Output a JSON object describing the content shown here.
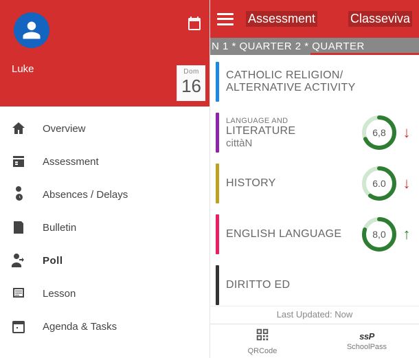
{
  "left": {
    "username": "Luke",
    "day": {
      "dow": "Dom",
      "num": "16"
    },
    "menu": [
      {
        "label": "Overview",
        "icon": "home",
        "bold": false
      },
      {
        "label": "Assessment",
        "icon": "grade",
        "bold": false
      },
      {
        "label": "Absences / Delays",
        "icon": "absence",
        "bold": false
      },
      {
        "label": "Bulletin",
        "icon": "bulletin",
        "bold": false
      },
      {
        "label": "Poll",
        "icon": "poll",
        "bold": true
      },
      {
        "label": "Lesson",
        "icon": "lesson",
        "bold": false
      },
      {
        "label": "Agenda & Tasks",
        "icon": "agenda",
        "bold": false
      }
    ]
  },
  "right": {
    "title": "Assessment",
    "brand": "Classeviva",
    "quarter_bar": "N 1 * QUARTER 2 * QUARTER",
    "subjects": [
      {
        "super": "",
        "name": "CATHOLIC RELIGION/ ALTERNATIVE ACTIVITY",
        "sub": "",
        "bar_color": "#1e88e5",
        "score": "",
        "trend": ""
      },
      {
        "super": "LANGUAGE AND",
        "name": "LITERATURE",
        "sub": "cittàN",
        "bar_color": "#8e24aa",
        "score": "6,8",
        "pct": 68,
        "trend": "down"
      },
      {
        "super": "",
        "name": "HISTORY",
        "sub": "",
        "bar_color": "#c0a020",
        "score": "6.0",
        "pct": 60,
        "trend": "down"
      },
      {
        "super": "",
        "name": "ENGLISH LANGUAGE",
        "sub": "",
        "bar_color": "#e91e63",
        "score": "8,0",
        "pct": 80,
        "trend": "up"
      },
      {
        "super": "",
        "name": "DIRITTO ED",
        "sub": "",
        "bar_color": "#333",
        "score": "",
        "pct": 0,
        "trend": ""
      }
    ],
    "last_updated": "Last Updated: Now",
    "bottom_nav": {
      "qrcode": "QRCode",
      "schoolpass": "SchoolPass"
    }
  },
  "colors": {
    "gauge_track": "#cfe8cf",
    "gauge_fill": "#2e7d32"
  }
}
